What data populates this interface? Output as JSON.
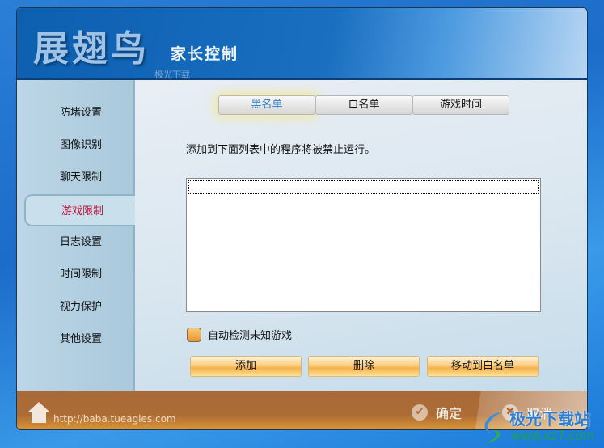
{
  "header": {
    "logo": "展翅鸟",
    "subtitle": "家长控制",
    "watermark": "极光下载"
  },
  "sidebar": {
    "items": [
      {
        "label": "防堵设置"
      },
      {
        "label": "图像识别"
      },
      {
        "label": "聊天限制"
      },
      {
        "label": "游戏限制",
        "active": true
      },
      {
        "label": "日志设置"
      },
      {
        "label": "时间限制"
      },
      {
        "label": "视力保护"
      },
      {
        "label": "其他设置"
      }
    ]
  },
  "main": {
    "tabs": [
      {
        "label": "黑名单",
        "selected": true
      },
      {
        "label": "白名单"
      },
      {
        "label": "游戏时间"
      }
    ],
    "description": "添加到下面列表中的程序将被禁止运行。",
    "list_items": [],
    "auto_detect": {
      "label": "自动检测未知游戏",
      "checked": false
    },
    "buttons": {
      "add": "添加",
      "delete": "删除",
      "move": "移动到白名单"
    }
  },
  "footer": {
    "url": "http://baba.tueagles.com",
    "ok": "确定",
    "cancel": "取消"
  },
  "brand_watermark": {
    "name": "极光下载站",
    "site": "www.xz7.com"
  },
  "colors": {
    "header": "#1a6fc0",
    "footer": "#ad6c36",
    "active_item": "#c0143c",
    "selected_tab": "#2a78c8"
  }
}
